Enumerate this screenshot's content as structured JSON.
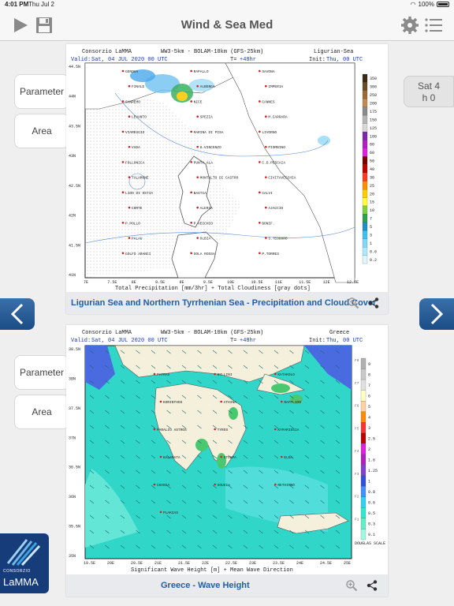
{
  "status": {
    "time": "4:01 PM",
    "date": "Thu Jul 2",
    "battery": "100%",
    "battery_level": 1.0
  },
  "app": {
    "title": "Wind & Sea Med"
  },
  "side_buttons": {
    "parameter": "Parameter",
    "area": "Area"
  },
  "date_chip": {
    "day": "Sat 4",
    "hour": "h 0"
  },
  "logo": {
    "sub": "CONSORZIO",
    "main": "LaMMA"
  },
  "map1": {
    "header_left": "Consorzio LaMMA",
    "header_center": "WW3-5km - BOLAM-10km (GFS-25km)",
    "header_right": "Ligurian-Sea",
    "valid_label": "Valid:",
    "valid_value": "Sat, 04 JUL 2020   00 UTC",
    "t_label": "T=",
    "t_value": "+48hr",
    "init_label": "Init:",
    "init_value": "Thu, 00 UTC",
    "lat_ticks": [
      "44.5N",
      "44N",
      "43.5N",
      "43N",
      "42.5N",
      "42N",
      "41.5N",
      "41N"
    ],
    "lon_ticks": [
      "7E",
      "7.5E",
      "8E",
      "8.5E",
      "9E",
      "9.5E",
      "10E",
      "10.5E",
      "11E",
      "11.5E",
      "12E",
      "12.5E"
    ],
    "scale_values": [
      "350",
      "300",
      "250",
      "200",
      "175",
      "150",
      "125",
      "100",
      "80",
      "60",
      "50",
      "40",
      "30",
      "25",
      "20",
      "15",
      "10",
      "7",
      "5",
      "3",
      "1",
      "0.6",
      "0.2"
    ],
    "scale_colors": [
      "#3a2a14",
      "#6b4a24",
      "#9a6a34",
      "#c08a50",
      "#8a8a8a",
      "#b5b5b5",
      "#d8d8d8",
      "#7a2aa8",
      "#b020c0",
      "#e020e0",
      "#7a0000",
      "#c00000",
      "#ff3a20",
      "#ff8c00",
      "#ffcc00",
      "#ffff40",
      "#80d040",
      "#30a050",
      "#2090c0",
      "#40c0f0",
      "#80d8f8",
      "#b0e8ff",
      "#e0f6ff"
    ],
    "places": [
      "GENOVA",
      "RAPALLO",
      "SAVONA",
      "FINALE",
      "ALBENGA",
      "IMPERIA",
      "SANREMO",
      "NICE",
      "CANNES",
      "LEVANTO",
      "SPEZIA",
      "M.CARRARA",
      "VIAREGGIO",
      "MARINA DI PISA",
      "LIVORNO",
      "VADA",
      "S.VINCENZO",
      "PIOMBINO",
      "FOLLONICA",
      "PUNTA ALA",
      "C.D.PESCAIA",
      "TALAMONE",
      "MONTALTO DI CASTRO",
      "CIVITAVECCHIA",
      "LIDO DI OSTIA",
      "BASTIA",
      "CALVI",
      "CORTE",
      "ALERIA",
      "AJACCIO",
      "P.POLLO",
      "P.VECCHIO",
      "BONIF.",
      "PALAU",
      "OLBIA",
      "S.TEODORO",
      "GOLFO ARANCI",
      "SOLA ROSSA",
      "P.TORRES"
    ],
    "caption": "Ligurian Sea and Northern Tyrrhenian Sea - Precipitation and Cloud Cover",
    "footer": "Total Precipitation [mm/3hr] + Total Cloudiness [gray dots]"
  },
  "map2": {
    "header_left": "Consorzio LaMMA",
    "header_center": "WW3-5km - BOLAM-10km (GFS-25km)",
    "header_right": "Greece",
    "valid_label": "Valid:",
    "valid_value": "Sat, 04 JUL 2020   00 UTC",
    "t_label": "T=",
    "t_value": "+48hr",
    "init_label": "Init:",
    "init_value": "Thu, 00 UTC",
    "lat_ticks": [
      "38.5N",
      "38N",
      "37.5N",
      "37N",
      "36.5N",
      "36N",
      "35.5N",
      "35N"
    ],
    "lon_ticks": [
      "19.5E",
      "20E",
      "20.5E",
      "21E",
      "21.5E",
      "22E",
      "22.5E",
      "23E",
      "23.5E",
      "24E",
      "24.5E",
      "25E"
    ],
    "scale_values": [
      "9",
      "8",
      "7",
      "6",
      "5",
      "4",
      "3",
      "2.5",
      "2",
      "1.6",
      "1.25",
      "1",
      "0.8",
      "0.6",
      "0.5",
      "0.3",
      "0.1"
    ],
    "douglas": [
      "F8",
      "F7",
      "F6",
      "F5",
      "F4",
      "F3",
      "F2",
      "F1"
    ],
    "douglas_label": "DOUGLAS SCALE",
    "scale_colors": [
      "#b0b0b0",
      "#c8c8c8",
      "#e0e0e0",
      "#ffffc0",
      "#ffd0a0",
      "#ff8c00",
      "#ff3030",
      "#c00000",
      "#e020e0",
      "#b020c0",
      "#8040d0",
      "#3050e0",
      "#4090ff",
      "#30d0f0",
      "#30e8d0",
      "#60f0c8",
      "#a0f8e0"
    ],
    "places": [
      "PATRAS",
      "KYLLINI",
      "KATAKOLO",
      "KORINTHOS",
      "ATHINA",
      "NAFPLION",
      "PARALIO ASTROS",
      "TYROS",
      "KYPARISSIA",
      "KALAMATA",
      "STOUPA",
      "ELEA",
      "CHANIA",
      "SOUGIA",
      "RETHIMNO",
      "PLAKIAS"
    ],
    "caption": "Greece - Wave Height",
    "footer": "Significant Wave Height [m] + Mean Wave Direction"
  }
}
